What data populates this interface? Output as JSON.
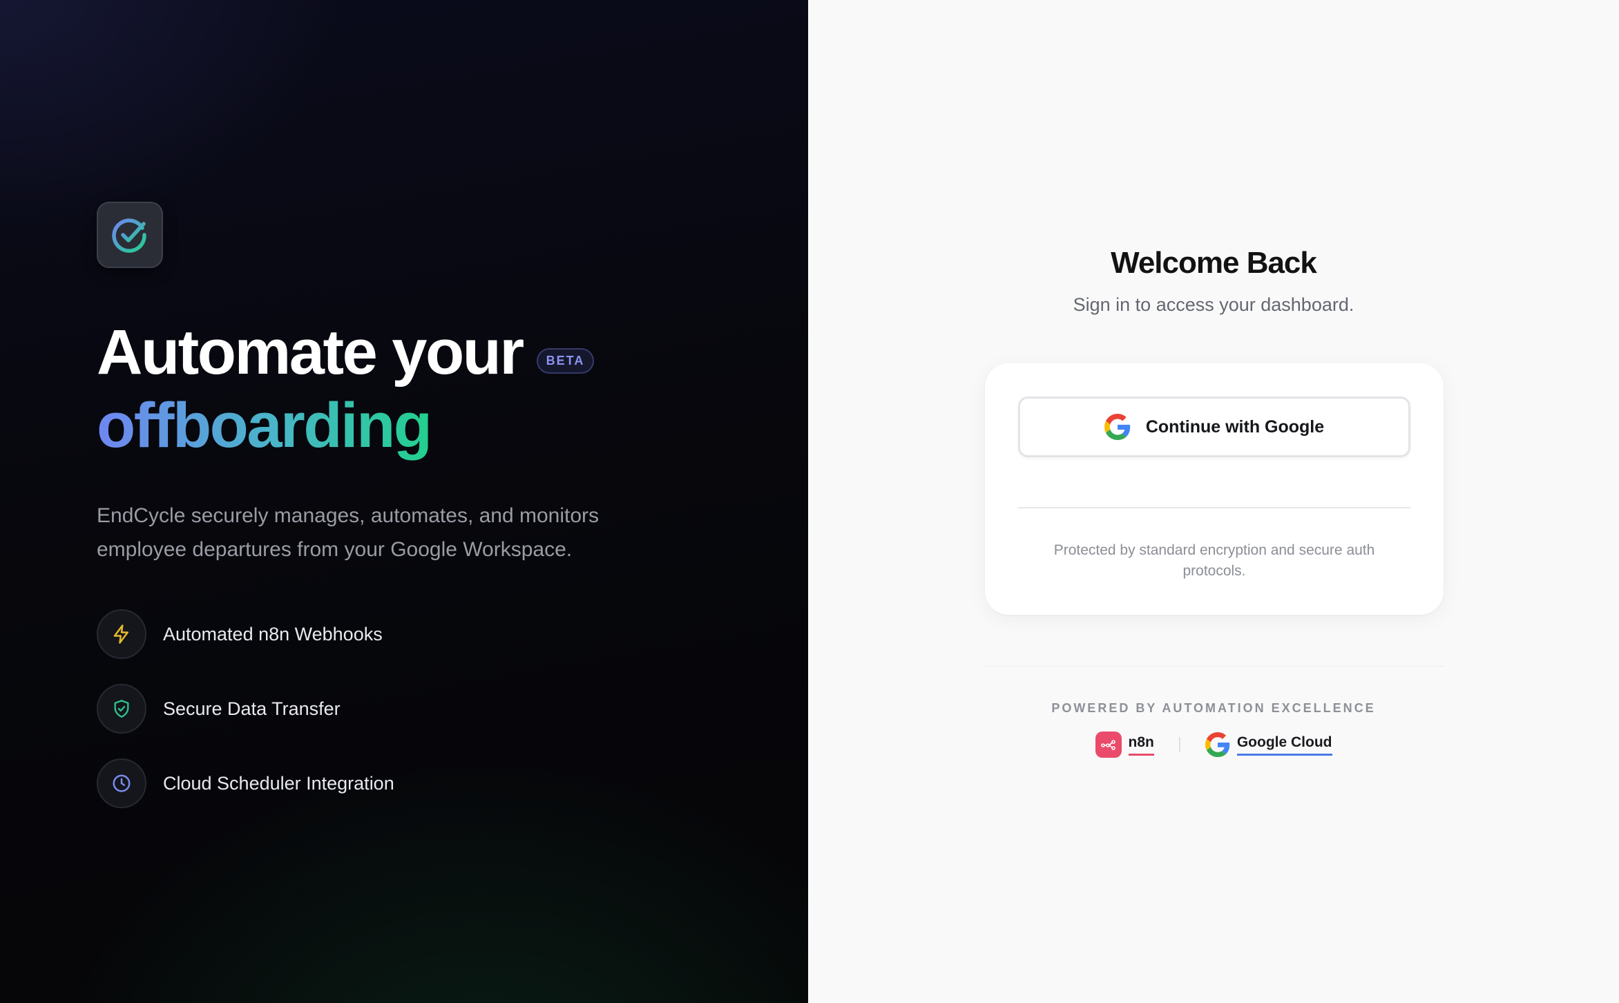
{
  "hero": {
    "logo_icon": "check-circle-icon",
    "headline": "Automate your",
    "badge": "BETA",
    "headline_accent": "offboarding",
    "description": "EndCycle securely manages, automates, and monitors employee departures from your Google Workspace.",
    "features": [
      {
        "icon": "lightning-icon",
        "label": "Automated n8n Webhooks",
        "color": "#e8b92a"
      },
      {
        "icon": "shield-check-icon",
        "label": "Secure Data Transfer",
        "color": "#2fc48c"
      },
      {
        "icon": "clock-icon",
        "label": "Cloud Scheduler Integration",
        "color": "#7b8cf0"
      }
    ]
  },
  "login": {
    "title": "Welcome Back",
    "subtitle": "Sign in to access your dashboard.",
    "google_button": "Continue with Google",
    "security_note": "Protected by standard encryption and secure auth protocols."
  },
  "footer": {
    "powered_by": "POWERED BY AUTOMATION EXCELLENCE",
    "partners": [
      {
        "icon": "n8n-logo-icon",
        "label": "n8n"
      },
      {
        "icon": "google-g-icon",
        "label": "Google Cloud"
      }
    ]
  },
  "colors": {
    "gradient_start": "#6f86f2",
    "gradient_end": "#22d08d",
    "n8n_brand": "#ea4b6a",
    "google_blue": "#4285f4"
  }
}
